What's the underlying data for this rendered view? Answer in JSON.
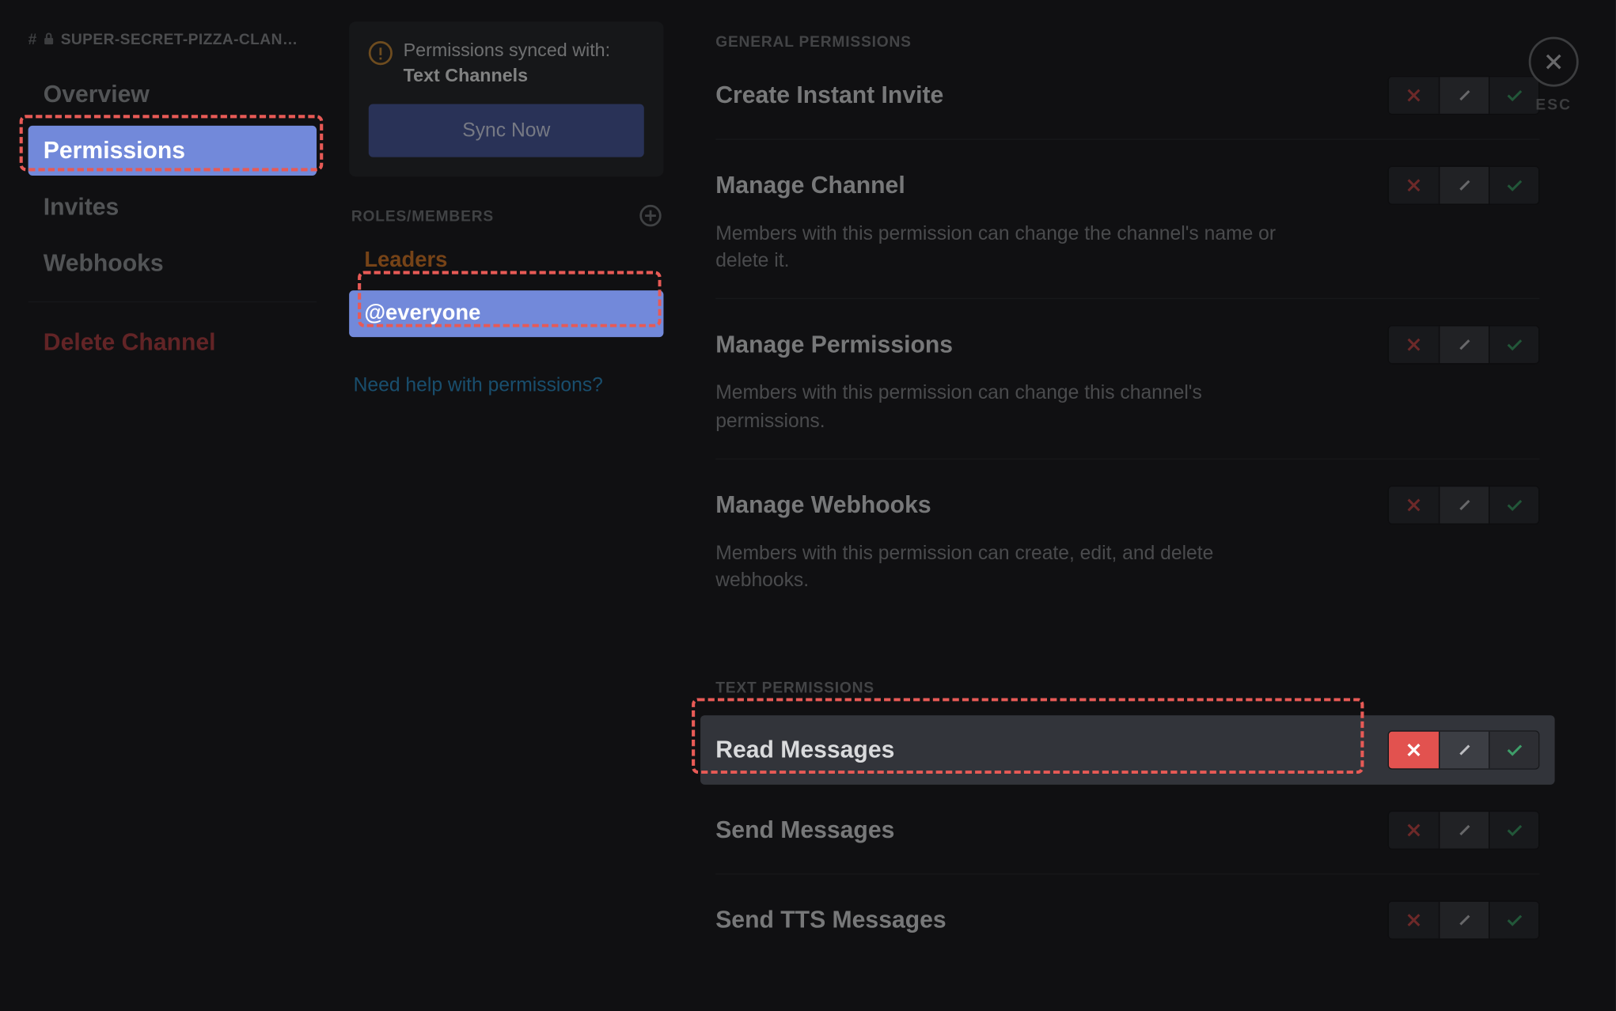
{
  "header": {
    "channel_name": "SUPER-SECRET-PIZZA-CLAN…",
    "close_label": "ESC"
  },
  "sidebar": {
    "items": [
      {
        "label": "Overview"
      },
      {
        "label": "Permissions"
      },
      {
        "label": "Invites"
      },
      {
        "label": "Webhooks"
      }
    ],
    "delete_label": "Delete Channel"
  },
  "sync_card": {
    "lead": "Permissions synced with:",
    "target": "Text Channels",
    "button": "Sync Now"
  },
  "roles": {
    "header": "ROLES/MEMBERS",
    "items": [
      {
        "label": "Leaders"
      },
      {
        "label": "@everyone"
      }
    ],
    "help_link": "Need help with permissions?"
  },
  "permissions": {
    "general_header": "GENERAL PERMISSIONS",
    "text_header": "TEXT PERMISSIONS",
    "general": [
      {
        "title": "Create Instant Invite",
        "desc": ""
      },
      {
        "title": "Manage Channel",
        "desc": "Members with this permission can change the channel's name or delete it."
      },
      {
        "title": "Manage Permissions",
        "desc": "Members with this permission can change this channel's permissions."
      },
      {
        "title": "Manage Webhooks",
        "desc": "Members with this permission can create, edit, and delete webhooks."
      }
    ],
    "text": [
      {
        "title": "Read Messages",
        "desc": ""
      },
      {
        "title": "Send Messages",
        "desc": ""
      },
      {
        "title": "Send TTS Messages",
        "desc": ""
      }
    ]
  }
}
